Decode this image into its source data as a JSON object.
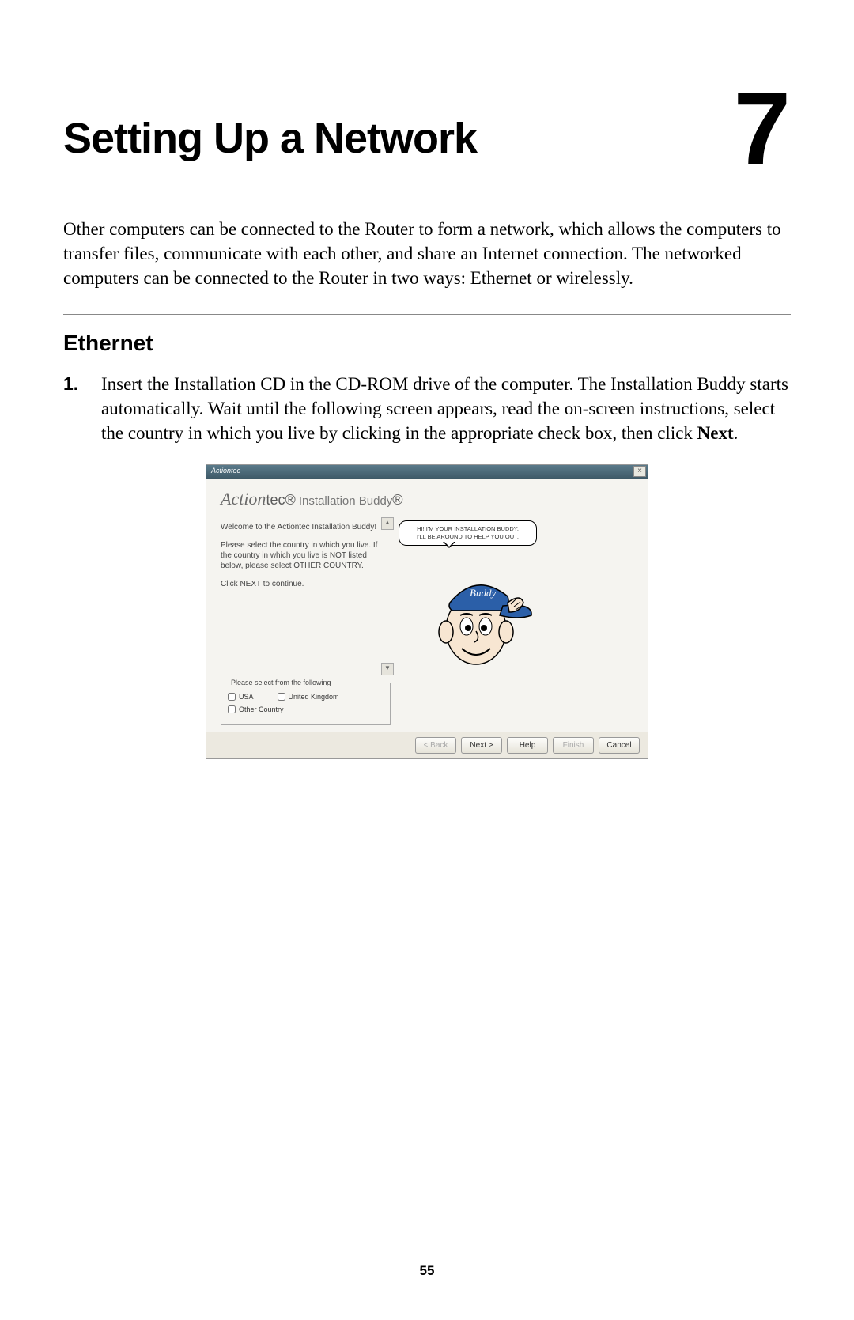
{
  "chapter": {
    "title": "Setting Up a Network",
    "number": "7"
  },
  "intro": "Other computers can be connected to the Router to form a network, which allows the computers to transfer files, communicate with each other, and share an Internet connection. The networked computers can be connected to the Router in two ways: Ethernet or wirelessly.",
  "section": {
    "title": "Ethernet"
  },
  "step1": {
    "num": "1.",
    "text_a": "Insert the Installation CD in the CD-ROM drive of the computer. The Installation Buddy starts automatically. Wait until the following screen appears, read the on-screen instructions, select the country in which you live by clicking in the appropriate check box, then click ",
    "text_bold": "Next",
    "text_b": "."
  },
  "dialog": {
    "titlebar": "Actiontec",
    "close": "×",
    "brand_script": "Action",
    "brand_rest": "tec",
    "brand_reg": "®",
    "brand_product": " Installation Buddy",
    "brand_reg2": "®",
    "instr_p1": "Welcome to the Actiontec Installation Buddy!",
    "instr_p2": "Please select the country in which you live. If the country in which you live is NOT listed below, please select OTHER COUNTRY.",
    "instr_p3": "Click NEXT to continue.",
    "fieldset_legend": "Please select from the following",
    "opt_usa": "USA",
    "opt_uk": "United Kingdom",
    "opt_other": "Other Country",
    "speech_l1": "HI! I'M YOUR INSTALLATION BUDDY.",
    "speech_l2": "I'LL BE AROUND TO HELP YOU OUT.",
    "buttons": {
      "back": "< Back",
      "next": "Next >",
      "help": "Help",
      "finish": "Finish",
      "cancel": "Cancel"
    }
  },
  "page_number": "55"
}
